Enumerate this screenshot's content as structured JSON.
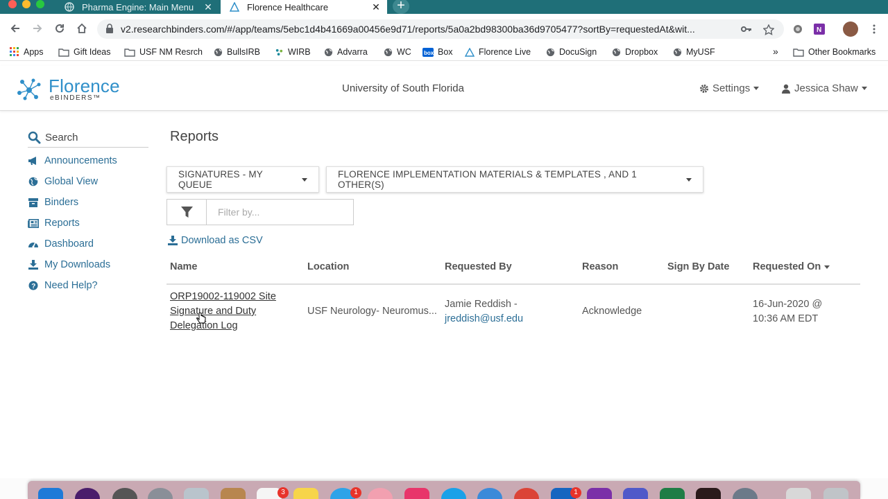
{
  "browser": {
    "tabs": [
      {
        "title": "Pharma Engine: Main Menu",
        "active": false
      },
      {
        "title": "Florence Healthcare",
        "active": true
      }
    ],
    "url": "v2.researchbinders.com/#/app/teams/5ebc1d4b41669a00456e9d71/reports/5a0a2bd98300ba36d9705477?sortBy=requestedAt&wit...",
    "bookmarks": [
      "Apps",
      "Gift Ideas",
      "USF NM Resrch",
      "BullsIRB",
      "WIRB",
      "Advarra",
      "WC",
      "Box",
      "Florence Live",
      "DocuSign",
      "Dropbox",
      "MyUSF"
    ],
    "other_bookmarks": "Other Bookmarks",
    "overflow": "»"
  },
  "header": {
    "logo_word": "Florence",
    "logo_sub": "eBINDERS™",
    "org": "University of South Florida",
    "settings": "Settings",
    "user": "Jessica Shaw"
  },
  "sidebar": {
    "search": "Search",
    "items": [
      {
        "label": "Announcements",
        "icon": "bullhorn-icon"
      },
      {
        "label": "Global View",
        "icon": "globe-icon"
      },
      {
        "label": "Binders",
        "icon": "archive-icon"
      },
      {
        "label": "Reports",
        "icon": "newspaper-icon"
      },
      {
        "label": "Dashboard",
        "icon": "dashboard-icon"
      },
      {
        "label": "My Downloads",
        "icon": "download-icon"
      },
      {
        "label": "Need Help?",
        "icon": "question-circle-icon"
      }
    ]
  },
  "main": {
    "title": "Reports",
    "report_type": "SIGNATURES - MY QUEUE",
    "scope": "FLORENCE IMPLEMENTATION MATERIALS & TEMPLATES , AND 1 OTHER(S)",
    "filter_placeholder": "Filter by...",
    "download": "Download as CSV",
    "columns": [
      "Name",
      "Location",
      "Requested By",
      "Reason",
      "Sign By Date",
      "Requested On"
    ],
    "rows": [
      {
        "name_lines": [
          "ORP19002-119002 Site",
          "Signature and Duty",
          "Delegation Log"
        ],
        "location": "USF Neurology- Neuromus...",
        "requested_by": "Jamie Reddish -",
        "email": "jreddish@usf.edu",
        "reason": "Acknowledge",
        "sign_by": "",
        "requested_on_lines": [
          "16-Jun-2020 @",
          "10:36 AM EDT"
        ]
      }
    ]
  },
  "dock": {
    "badges": [
      "3",
      "1",
      "1"
    ]
  },
  "colors": {
    "tabstrip": "#1f6f78",
    "link": "#2b6e96",
    "brand": "#2f8fc9"
  }
}
